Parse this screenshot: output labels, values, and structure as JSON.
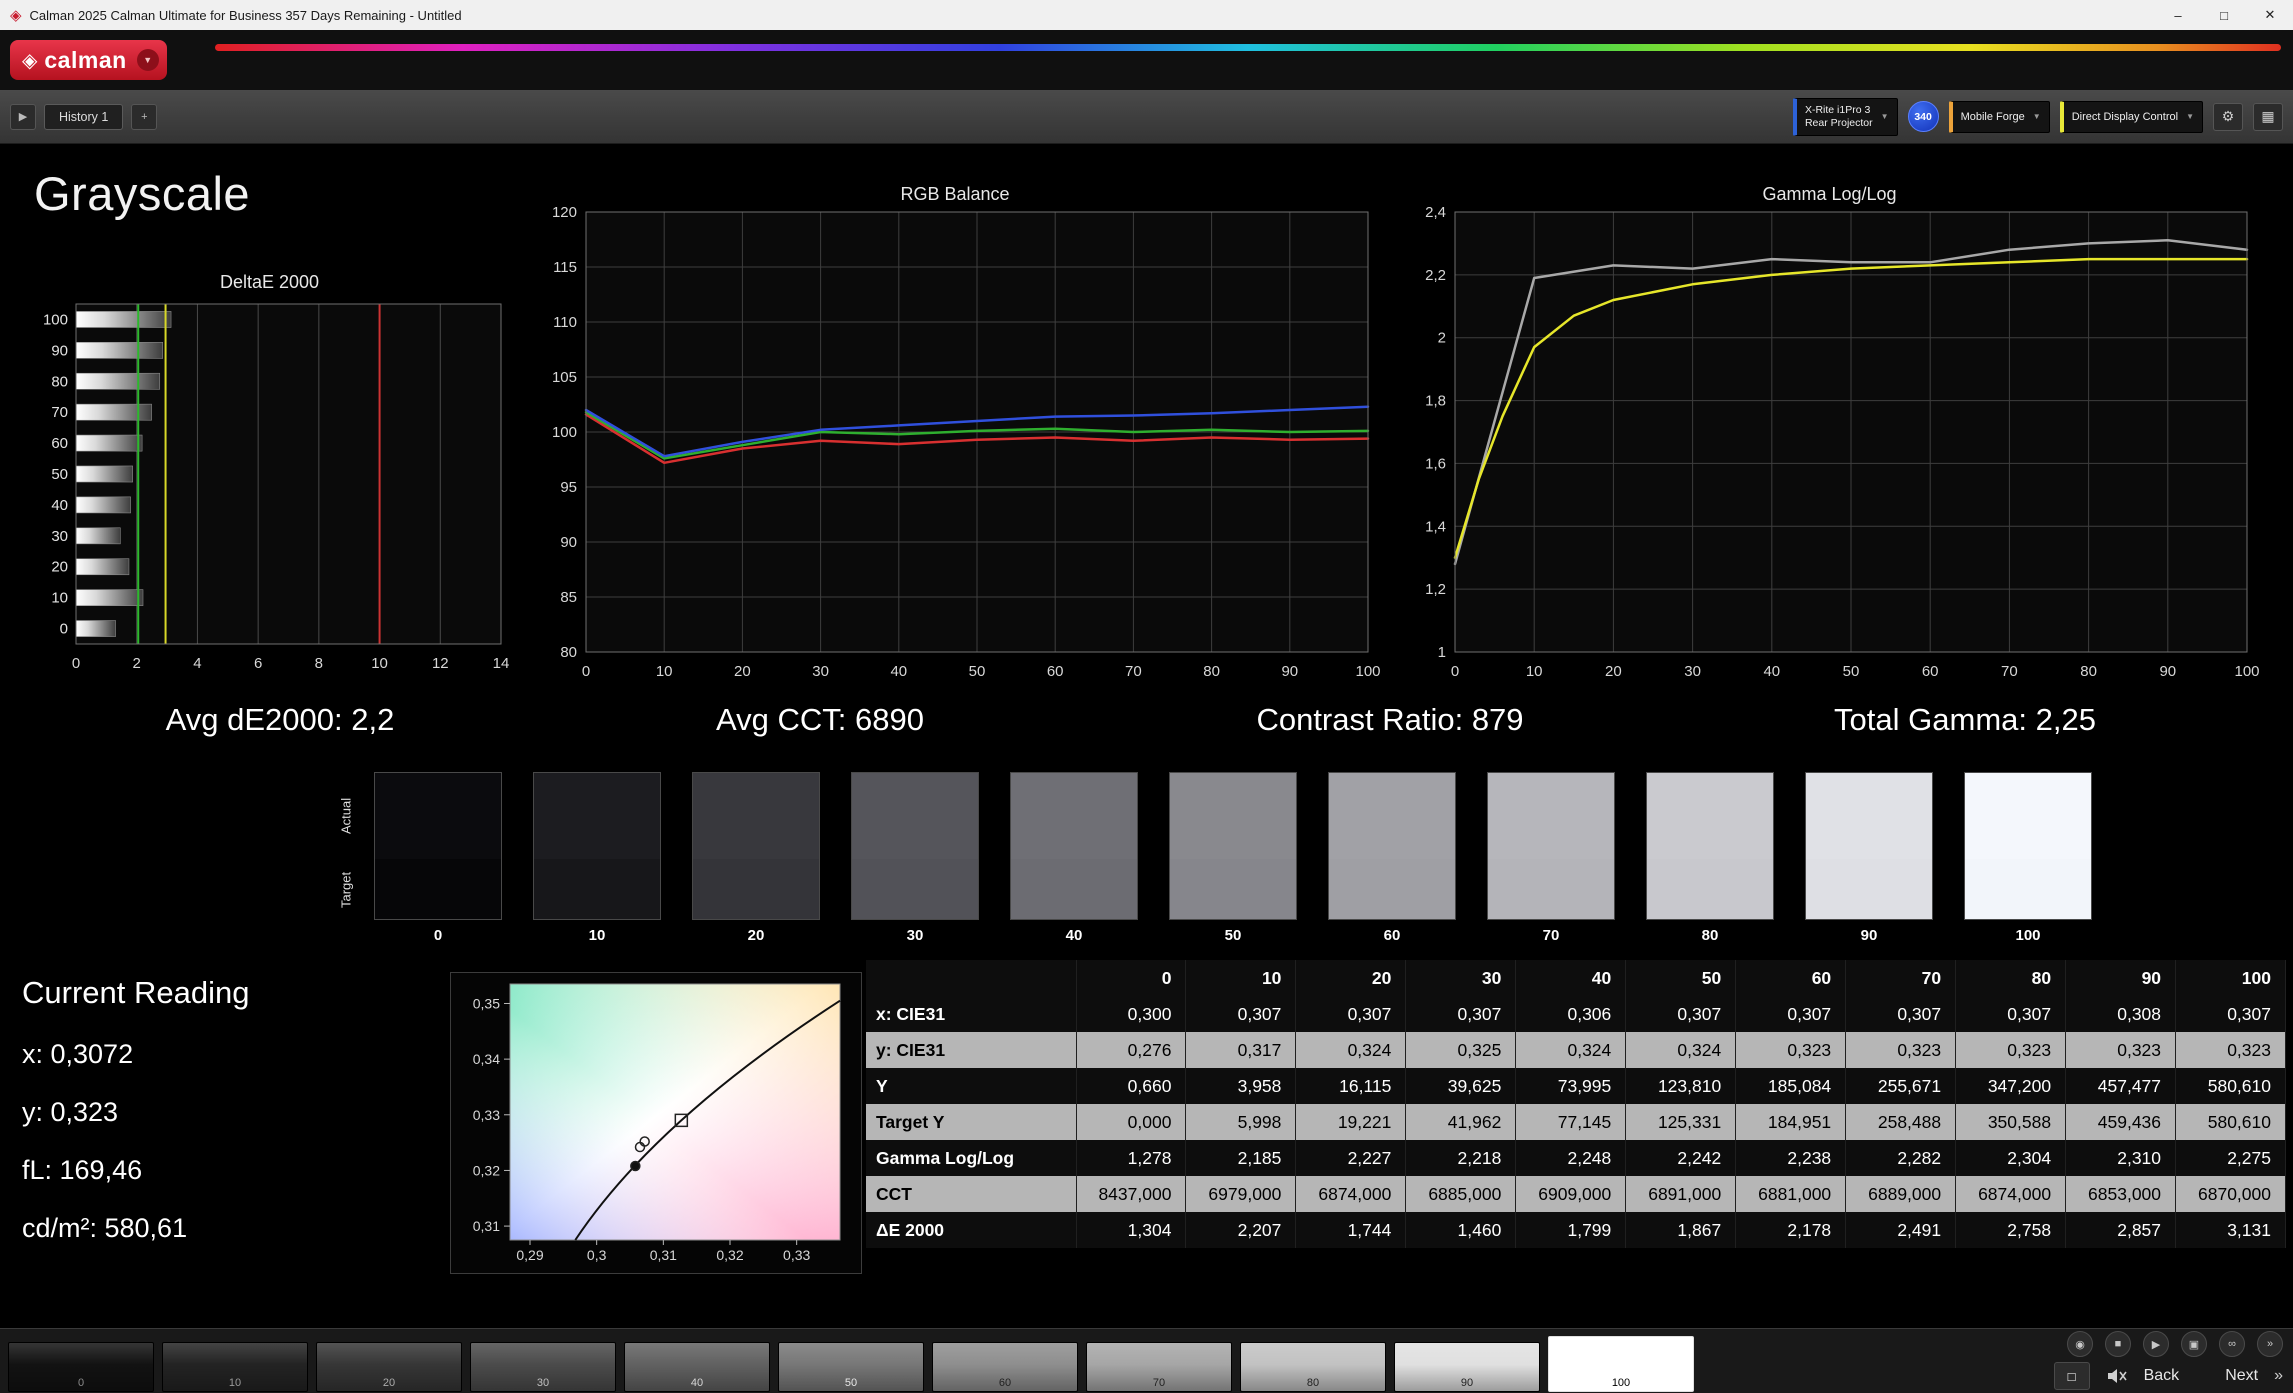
{
  "titlebar": {
    "title": "Calman 2025 Calman Ultimate for Business 357 Days Remaining - Untitled"
  },
  "brand": {
    "name": "calman"
  },
  "icons": {
    "app": "◈",
    "logo_mark": "◈",
    "minimize": "–",
    "maximize": "□",
    "close": "✕",
    "dropdown": "▼",
    "gear": "⚙",
    "grid": "▦",
    "play": "▶",
    "plus": "+",
    "pattern_window": "□",
    "skip": "»"
  },
  "toolbar": {
    "history_tab": "History 1",
    "meter_line1": "X-Rite i1Pro 3",
    "meter_line2": "Rear Projector",
    "badge": "340",
    "source": "Mobile Forge",
    "pattern": "Direct Display Control"
  },
  "page": {
    "title": "Grayscale"
  },
  "summary": [
    "Avg dE2000: 2,2",
    "Avg CCT: 6890",
    "Contrast Ratio: 879",
    "Total Gamma: 2,25"
  ],
  "chart_data": [
    {
      "type": "bar",
      "orientation": "horizontal",
      "title": "DeltaE 2000",
      "categories": [
        "100",
        "90",
        "80",
        "70",
        "60",
        "50",
        "40",
        "30",
        "20",
        "10",
        "0"
      ],
      "values": [
        3.131,
        2.857,
        2.758,
        2.491,
        2.178,
        1.867,
        1.799,
        1.46,
        1.744,
        2.207,
        1.304
      ],
      "xlim": [
        0,
        14
      ],
      "xticks": [
        0,
        2,
        4,
        6,
        8,
        10,
        12,
        14
      ],
      "reference_lines": [
        {
          "name": "average",
          "value": 2.05,
          "color": "#2db82d"
        },
        {
          "name": "tolerance",
          "value": 2.95,
          "color": "#d8d828"
        },
        {
          "name": "limit",
          "value": 10,
          "color": "#cc3333"
        }
      ]
    },
    {
      "type": "line",
      "title": "RGB Balance",
      "x": [
        0,
        10,
        20,
        30,
        40,
        50,
        60,
        70,
        80,
        90,
        100
      ],
      "series": [
        {
          "name": "Red",
          "color": "#d83030",
          "values": [
            101.6,
            97.2,
            98.5,
            99.2,
            98.9,
            99.3,
            99.5,
            99.2,
            99.5,
            99.3,
            99.4
          ]
        },
        {
          "name": "Green",
          "color": "#2faf2f",
          "values": [
            101.8,
            97.6,
            98.8,
            100.0,
            99.8,
            100.1,
            100.3,
            100.0,
            100.2,
            100.0,
            100.1
          ]
        },
        {
          "name": "Blue",
          "color": "#3050dd",
          "values": [
            102.0,
            97.8,
            99.1,
            100.2,
            100.6,
            101.0,
            101.4,
            101.5,
            101.7,
            102.0,
            102.3
          ]
        }
      ],
      "ylim": [
        80,
        120
      ],
      "yticks": [
        80,
        85,
        90,
        95,
        100,
        105,
        110,
        115,
        120
      ],
      "xticks": [
        0,
        10,
        20,
        30,
        40,
        50,
        60,
        70,
        80,
        90,
        100
      ]
    },
    {
      "type": "line",
      "title": "Gamma Log/Log",
      "series": [
        {
          "name": "Measured",
          "color": "#a8a8a8",
          "x": [
            0,
            10,
            20,
            30,
            40,
            50,
            60,
            70,
            80,
            90,
            100
          ],
          "values": [
            1.28,
            2.19,
            2.23,
            2.22,
            2.25,
            2.24,
            2.24,
            2.28,
            2.3,
            2.31,
            2.28
          ]
        },
        {
          "name": "Target",
          "color": "#e6e62a",
          "x": [
            0,
            3,
            6,
            10,
            15,
            20,
            30,
            40,
            50,
            60,
            70,
            80,
            90,
            100
          ],
          "values": [
            1.3,
            1.55,
            1.75,
            1.97,
            2.07,
            2.12,
            2.17,
            2.2,
            2.22,
            2.23,
            2.24,
            2.25,
            2.25,
            2.25
          ]
        }
      ],
      "ylim": [
        1.0,
        2.4
      ],
      "yticks": [
        1,
        1.2,
        1.4,
        1.6,
        1.8,
        2,
        2.2,
        2.4
      ],
      "ytick_labels": [
        "1",
        "1,2",
        "1,4",
        "1,6",
        "1,8",
        "2",
        "2,2",
        "2,4"
      ],
      "xticks": [
        0,
        10,
        20,
        30,
        40,
        50,
        60,
        70,
        80,
        90,
        100
      ]
    },
    {
      "type": "scatter",
      "title": "",
      "xlim": [
        0.287,
        0.3365
      ],
      "ylim": [
        0.3075,
        0.3535
      ],
      "xticks": [
        0.29,
        0.3,
        0.31,
        0.32,
        0.33
      ],
      "xtick_labels": [
        "0,29",
        "0,3",
        "0,31",
        "0,32",
        "0,33"
      ],
      "yticks": [
        0.31,
        0.32,
        0.33,
        0.34,
        0.35
      ],
      "ytick_labels": [
        "0,31",
        "0,32",
        "0,33",
        "0,34",
        "0,35"
      ],
      "locus": [
        [
          0.2968,
          0.3075
        ],
        [
          0.3127,
          0.329
        ],
        [
          0.3365,
          0.3505
        ]
      ],
      "target": {
        "x": 0.3127,
        "y": 0.329,
        "marker": "square"
      },
      "points": [
        {
          "x": 0.3072,
          "y": 0.3252,
          "filled": false
        },
        {
          "x": 0.3065,
          "y": 0.3242,
          "filled": false
        },
        {
          "x": 0.3058,
          "y": 0.3208,
          "filled": true
        }
      ]
    }
  ],
  "swatches": {
    "actual_label": "Actual",
    "target_label": "Target",
    "levels": [
      {
        "label": "0",
        "actual": "#0b0b0e",
        "target": "#060608"
      },
      {
        "label": "10",
        "actual": "#1c1c20",
        "target": "#17171a"
      },
      {
        "label": "20",
        "actual": "#38383d",
        "target": "#343439"
      },
      {
        "label": "30",
        "actual": "#55555b",
        "target": "#525258"
      },
      {
        "label": "40",
        "actual": "#6f6f75",
        "target": "#6c6c72"
      },
      {
        "label": "50",
        "actual": "#89898e",
        "target": "#86868c"
      },
      {
        "label": "60",
        "actual": "#a1a1a6",
        "target": "#9f9fa4"
      },
      {
        "label": "70",
        "actual": "#b6b6bb",
        "target": "#b4b4b9"
      },
      {
        "label": "80",
        "actual": "#cacacf",
        "target": "#c8c8cd"
      },
      {
        "label": "90",
        "actual": "#e0e1e6",
        "target": "#dedfe4"
      },
      {
        "label": "100",
        "actual": "#f4f7fc",
        "target": "#f2f5fa"
      }
    ]
  },
  "current_reading": {
    "title": "Current Reading",
    "lines": [
      "x: 0,3072",
      "y: 0,323",
      "fL: 169,46",
      "cd/m²: 580,61"
    ]
  },
  "table": {
    "columns": [
      "0",
      "10",
      "20",
      "30",
      "40",
      "50",
      "60",
      "70",
      "80",
      "90",
      "100"
    ],
    "rows": [
      {
        "label": "x: CIE31",
        "values": [
          "0,300",
          "0,307",
          "0,307",
          "0,307",
          "0,306",
          "0,307",
          "0,307",
          "0,307",
          "0,307",
          "0,308",
          "0,307"
        ]
      },
      {
        "label": "y: CIE31",
        "values": [
          "0,276",
          "0,317",
          "0,324",
          "0,325",
          "0,324",
          "0,324",
          "0,323",
          "0,323",
          "0,323",
          "0,323",
          "0,323"
        ]
      },
      {
        "label": "Y",
        "values": [
          "0,660",
          "3,958",
          "16,115",
          "39,625",
          "73,995",
          "123,810",
          "185,084",
          "255,671",
          "347,200",
          "457,477",
          "580,610"
        ]
      },
      {
        "label": "Target Y",
        "values": [
          "0,000",
          "5,998",
          "19,221",
          "41,962",
          "77,145",
          "125,331",
          "184,951",
          "258,488",
          "350,588",
          "459,436",
          "580,610"
        ]
      },
      {
        "label": "Gamma Log/Log",
        "values": [
          "1,278",
          "2,185",
          "2,227",
          "2,218",
          "2,248",
          "2,242",
          "2,238",
          "2,282",
          "2,304",
          "2,310",
          "2,275"
        ]
      },
      {
        "label": "CCT",
        "values": [
          "8437,000",
          "6979,000",
          "6874,000",
          "6885,000",
          "6909,000",
          "6891,000",
          "6881,000",
          "6889,000",
          "6874,000",
          "6853,000",
          "6870,000"
        ]
      },
      {
        "label": "ΔE 2000",
        "values": [
          "1,304",
          "2,207",
          "1,744",
          "1,460",
          "1,799",
          "1,867",
          "2,178",
          "2,491",
          "2,758",
          "2,857",
          "3,131"
        ]
      }
    ]
  },
  "bottombar": {
    "selected": "100",
    "back_label": "Back",
    "next_label": "Next",
    "patterns": [
      {
        "label": "0",
        "color": "#121212",
        "text": "#8a8a8a"
      },
      {
        "label": "10",
        "color": "#232323",
        "text": "#9a9a9a"
      },
      {
        "label": "20",
        "color": "#363636",
        "text": "#ababab"
      },
      {
        "label": "30",
        "color": "#4b4b4b",
        "text": "#c0c0c0"
      },
      {
        "label": "40",
        "color": "#616161",
        "text": "#d6d6d6"
      },
      {
        "label": "50",
        "color": "#777777",
        "text": "#e8e8e8"
      },
      {
        "label": "60",
        "color": "#8e8e8e",
        "text": "#222222"
      },
      {
        "label": "70",
        "color": "#a6a6a6",
        "text": "#222222"
      },
      {
        "label": "80",
        "color": "#c2c2c2",
        "text": "#222222"
      },
      {
        "label": "90",
        "color": "#e0e0e0",
        "text": "#222222"
      },
      {
        "label": "100",
        "color": "#ffffff",
        "text": "#000000"
      }
    ],
    "transport_icons": [
      {
        "name": "snapshot-icon",
        "glyph": "◉"
      },
      {
        "name": "stop-icon",
        "glyph": "■"
      },
      {
        "name": "play-icon",
        "glyph": "▶"
      },
      {
        "name": "pattern-check-icon",
        "glyph": "▣"
      },
      {
        "name": "continuous-icon",
        "glyph": "∞"
      },
      {
        "name": "skip-icon",
        "glyph": "»"
      }
    ]
  }
}
